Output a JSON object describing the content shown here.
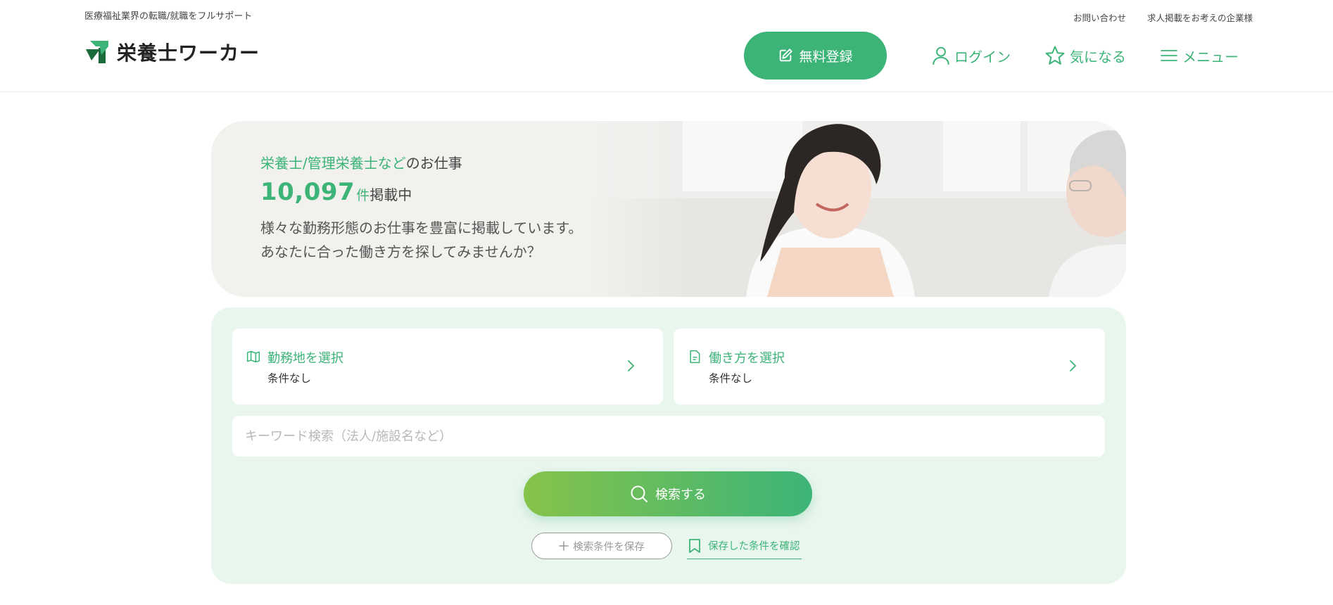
{
  "header": {
    "tagline": "医療福祉業界の転職/就職をフルサポート",
    "logo_text": "栄養士ワーカー",
    "top_links": [
      "お問い合わせ",
      "求人掲載をお考えの企業様"
    ],
    "nav": {
      "register_label": "無料登録",
      "login_label": "ログイン",
      "favorite_label": "気になる",
      "menu_label": "メニュー"
    }
  },
  "hero": {
    "accent_text": "栄養士/管理栄養士など",
    "line1_rest": "のお仕事",
    "count": "10,097",
    "count_unit": "件",
    "count_tail": "掲載中",
    "desc_line1": "様々な勤務形態のお仕事を豊富に掲載しています。",
    "desc_line2": "あなたに合った働き方を探してみませんか？"
  },
  "search": {
    "location": {
      "title": "勤務地を選択",
      "value": "条件なし",
      "icon": "map-icon"
    },
    "workstyle": {
      "title": "働き方を選択",
      "value": "条件なし",
      "icon": "document-icon"
    },
    "keyword_placeholder": "キーワード検索（法人/施設名など）",
    "keyword_value": "",
    "search_button_label": "検索する",
    "save_button_label": "検索条件を保存",
    "saved_link_label": "保存した条件を確認"
  },
  "colors": {
    "accent": "#3cb478",
    "gradient_start": "#86c34a",
    "panel_bg": "#e9f6ee",
    "hero_bg": "#f3f1ee"
  }
}
